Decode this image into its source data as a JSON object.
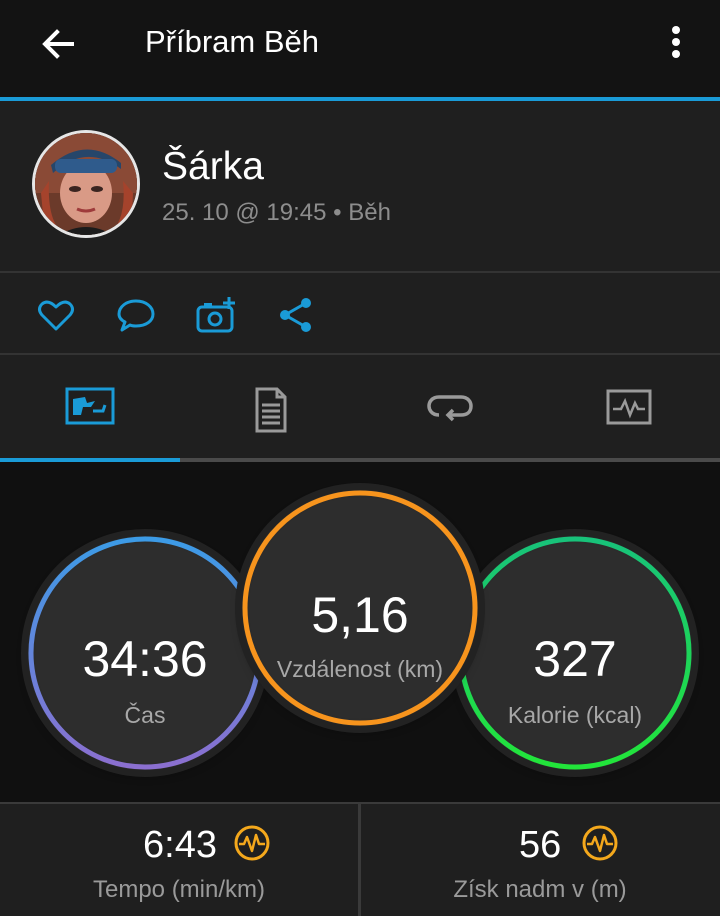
{
  "header": {
    "title": "Příbram Běh"
  },
  "activity": {
    "user_name": "Šárka",
    "meta": "25. 10 @ 19:45 • Běh"
  },
  "actions": [
    {
      "icon": "heart-icon"
    },
    {
      "icon": "comment-icon"
    },
    {
      "icon": "add-photo-icon"
    },
    {
      "icon": "share-icon"
    }
  ],
  "tabs": [
    {
      "icon": "overview-icon",
      "active": true
    },
    {
      "icon": "details-list-icon",
      "active": false
    },
    {
      "icon": "laps-icon",
      "active": false
    },
    {
      "icon": "charts-icon",
      "active": false
    }
  ],
  "summary": {
    "time": {
      "value": "34:36",
      "label": "Čas"
    },
    "distance": {
      "value": "5,16",
      "label": "Vzdálenost (km)"
    },
    "calories": {
      "value": "327",
      "label": "Kalorie (kcal)"
    }
  },
  "stats": {
    "pace": {
      "value": "6:43",
      "label": "Tempo (min/km)"
    },
    "elevation": {
      "value": "56",
      "label": "Získ nadm v (m)"
    }
  },
  "colors": {
    "accent": "#1a9bd7",
    "time_ring": "#4d8fe0",
    "distance_ring": "#f7941d",
    "calories_ring": "#1ed64a",
    "stat_icon": "#f4a81c"
  }
}
